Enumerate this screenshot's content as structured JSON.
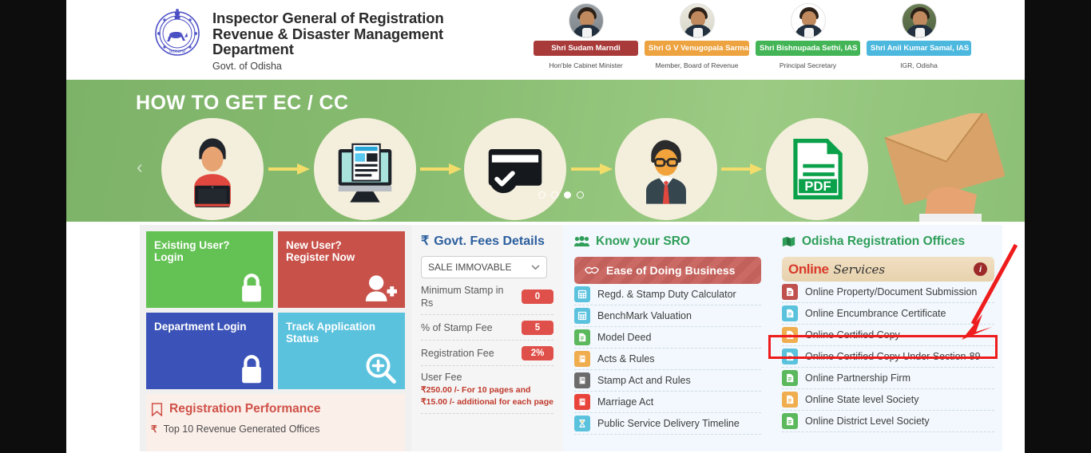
{
  "header": {
    "emblem_alt": "odisha-state-emblem",
    "title_line1": "Inspector General of Registration",
    "title_line2": "Revenue & Disaster Management",
    "title_line3": "Department",
    "subtitle": "Govt. of Odisha",
    "officials": [
      {
        "name": "Shri Sudam Marndi",
        "role": "Hon'ble Cabinet Minister",
        "color": "#a83a3a"
      },
      {
        "name": "Shri G V Venugopala Sarma, IAS",
        "role": "Member, Board of Revenue",
        "color": "#eda340"
      },
      {
        "name": "Shri Bishnupada Sethi, IAS",
        "role": "Principal Secretary",
        "color": "#43b556"
      },
      {
        "name": "Shri Anil Kumar Samal, IAS",
        "role": "IGR, Odisha",
        "color": "#4cb8de"
      }
    ]
  },
  "banner": {
    "title": "HOW TO GET EC / CC",
    "prev_icon": "chevron-left-icon",
    "next_icon": "chevron-right-icon",
    "slides_total": 4,
    "slide_active_index": 3,
    "steps": [
      "user-with-laptop-icon",
      "online-application-monitor-icon",
      "card-payment-verified-icon",
      "officer-review-icon",
      "pdf-certificate-icon"
    ]
  },
  "tiles": [
    {
      "line1": "Existing User?",
      "line2": "Login",
      "icon": "lock-icon",
      "color": "#64c254"
    },
    {
      "line1": "New User?",
      "line2": "Register Now",
      "icon": "add-user-icon",
      "color": "#c8514a"
    },
    {
      "line1": "Department Login",
      "line2": "",
      "icon": "lock-icon",
      "color": "#3b53b8"
    },
    {
      "line1": "Track Application",
      "line2": "Status",
      "icon": "search-plus-icon",
      "color": "#5bc2de"
    }
  ],
  "performance": {
    "icon": "bookmark-icon",
    "title": "Registration Performance",
    "item_icon": "rupee-icon",
    "item": "Top 10 Revenue Generated Offices"
  },
  "fees": {
    "icon": "rupee-icon",
    "title": "Govt. Fees Details",
    "select_value": "SALE IMMOVABLE",
    "select_caret": "chevron-down-icon",
    "rows": [
      {
        "label": "Minimum Stamp in Rs",
        "value": "0"
      },
      {
        "label": "% of Stamp Fee",
        "value": "5"
      },
      {
        "label": "Registration Fee",
        "value": "2%"
      }
    ],
    "user_fee_label": "User Fee",
    "user_fee_value": "₹250.00 /-  For 10 pages and ₹15.00 /- additional  for each page"
  },
  "sro": {
    "icon": "group-users-icon",
    "title": "Know your SRO",
    "banner": {
      "icon": "handshake-icon",
      "label": "Ease of Doing Business"
    },
    "items": [
      {
        "label": "Regd. & Stamp Duty Calculator",
        "icon": "calculator-icon",
        "color": "#5bc2de"
      },
      {
        "label": "BenchMark Valuation",
        "icon": "calculator-icon",
        "color": "#5bc2de"
      },
      {
        "label": "Model Deed",
        "icon": "document-icon",
        "color": "#5cb85c"
      },
      {
        "label": "Acts & Rules",
        "icon": "book-icon",
        "color": "#f0ad4e"
      },
      {
        "label": "Stamp Act and Rules",
        "icon": "book-icon",
        "color": "#6b6b6b"
      },
      {
        "label": "Marriage Act",
        "icon": "book-icon",
        "color": "#e8443c"
      },
      {
        "label": "Public Service Delivery Timeline",
        "icon": "hourglass-icon",
        "color": "#5bc2de"
      }
    ]
  },
  "offices": {
    "icon": "map-icon",
    "title": "Odisha Registration Offices",
    "online_bar": {
      "word1": "Online",
      "word2": "Services",
      "info_icon": "info-icon"
    },
    "items": [
      {
        "label": "Online Property/Document Submission",
        "icon": "document-icon",
        "color": "#c0504d"
      },
      {
        "label": "Online Encumbrance Certificate",
        "icon": "document-icon",
        "color": "#5bc2de"
      },
      {
        "label": "Online Certified Copy",
        "icon": "document-icon",
        "color": "#f0ad4e"
      },
      {
        "label": "Online Certified Copy Under Section-89",
        "icon": "document-icon",
        "color": "#5bc2de"
      },
      {
        "label": "Online Partnership Firm",
        "icon": "document-icon",
        "color": "#5cb85c"
      },
      {
        "label": "Online State level Society",
        "icon": "document-icon",
        "color": "#f0ad4e"
      },
      {
        "label": "Online District Level Society",
        "icon": "document-icon",
        "color": "#5cb85c"
      }
    ]
  },
  "annotation": {
    "highlight_target": "Online Encumbrance Certificate",
    "color": "#ee1c1c",
    "arrow": "red-arrow-pointing-down-left"
  }
}
